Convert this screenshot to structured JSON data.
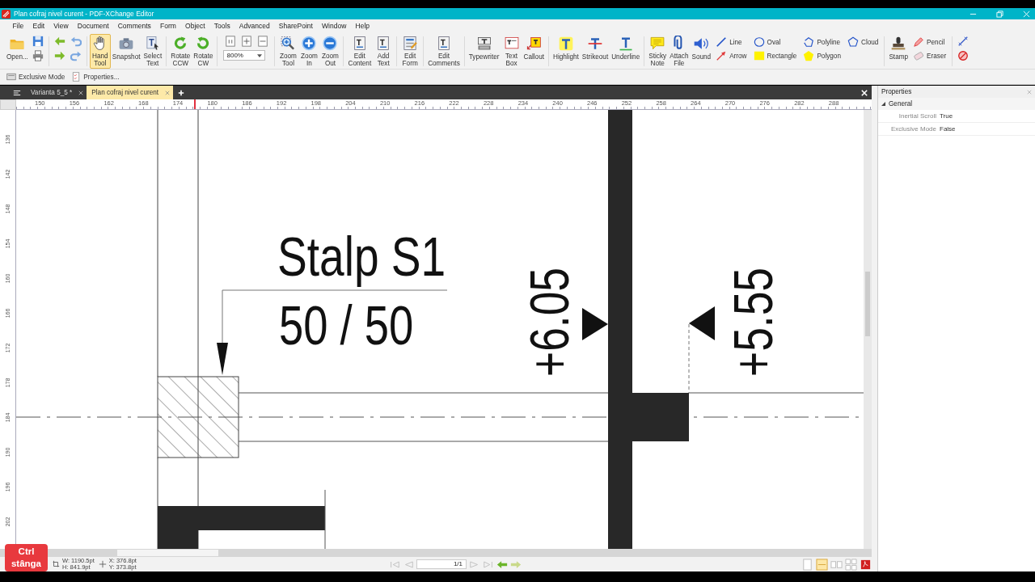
{
  "window": {
    "title": "Plan cofraj nivel curent - PDF-XChange Editor"
  },
  "menu": [
    "File",
    "Edit",
    "View",
    "Document",
    "Comments",
    "Form",
    "Object",
    "Tools",
    "Advanced",
    "SharePoint",
    "Window",
    "Help"
  ],
  "toolbar": [
    {
      "kind": "large",
      "label": "Open...",
      "selected": false
    },
    {
      "kind": "icons"
    },
    {
      "kind": "sep"
    },
    {
      "kind": "icons"
    },
    {
      "kind": "icons"
    },
    {
      "kind": "sep"
    },
    {
      "kind": "large",
      "label": "Hand Tool",
      "selected": true
    },
    {
      "kind": "large",
      "label": "Snapshot",
      "selected": false
    },
    {
      "kind": "large",
      "label": "Select Text",
      "selected": false
    },
    {
      "kind": "sep"
    },
    {
      "kind": "large",
      "label": "Rotate CCW",
      "selected": false
    },
    {
      "kind": "large",
      "label": "Rotate CW",
      "selected": false
    },
    {
      "kind": "sep"
    },
    {
      "kind": "zoom",
      "value": "800%"
    },
    {
      "kind": "sep"
    },
    {
      "kind": "large",
      "label": "Zoom Tool",
      "selected": false
    },
    {
      "kind": "large",
      "label": "Zoom In",
      "selected": false
    },
    {
      "kind": "large",
      "label": "Zoom Out",
      "selected": false
    },
    {
      "kind": "sep"
    },
    {
      "kind": "large",
      "label": "Edit Content",
      "selected": false
    },
    {
      "kind": "large",
      "label": "Add Text",
      "selected": false
    },
    {
      "kind": "sep"
    },
    {
      "kind": "large",
      "label": "Edit Form",
      "selected": false
    },
    {
      "kind": "sep"
    },
    {
      "kind": "large",
      "label": "Edit Comments",
      "selected": false
    },
    {
      "kind": "sep"
    },
    {
      "kind": "large",
      "label": "Typewriter",
      "selected": false
    },
    {
      "kind": "large",
      "label": "Text Box",
      "selected": false
    },
    {
      "kind": "large",
      "label": "Callout",
      "selected": false
    },
    {
      "kind": "sep"
    },
    {
      "kind": "large",
      "label": "Highlight",
      "selected": false
    },
    {
      "kind": "large",
      "label": "Strikeout",
      "selected": false
    },
    {
      "kind": "large",
      "label": "Underline",
      "selected": false
    },
    {
      "kind": "sep"
    },
    {
      "kind": "large",
      "label": "Sticky Note",
      "selected": false
    },
    {
      "kind": "large",
      "label": "Attach File",
      "selected": false
    },
    {
      "kind": "large",
      "label": "Sound",
      "selected": false
    },
    {
      "kind": "pair",
      "items": [
        "Line",
        "Arrow"
      ]
    },
    {
      "kind": "pair",
      "items": [
        "Oval",
        "Rectangle"
      ]
    },
    {
      "kind": "pair",
      "items": [
        "Polyline",
        "Polygon"
      ]
    },
    {
      "kind": "pair",
      "items": [
        "Cloud"
      ]
    },
    {
      "kind": "sep"
    },
    {
      "kind": "large",
      "label": "Stamp",
      "selected": false
    },
    {
      "kind": "pair",
      "items": [
        "Pencil",
        "Eraser"
      ]
    },
    {
      "kind": "sep"
    },
    {
      "kind": "icons"
    }
  ],
  "toolbar2": [
    "Exclusive Mode",
    "Properties..."
  ],
  "tabs": [
    {
      "label": "Varianta 5_5 *",
      "selected": false
    },
    {
      "label": "Plan cofraj nivel curent",
      "selected": true
    }
  ],
  "ruler": {
    "horizontal": [
      "150",
      "156",
      "162",
      "168",
      "174",
      "180",
      "186",
      "192",
      "198",
      "204",
      "210",
      "216",
      "222",
      "228",
      "234",
      "240",
      "246",
      "252",
      "258",
      "264",
      "270",
      "276",
      "282",
      "288"
    ],
    "vertical": [
      "136",
      "142",
      "148",
      "154",
      "160",
      "166",
      "172",
      "178",
      "184",
      "190",
      "196",
      "202"
    ]
  },
  "drawing": {
    "title": "Stalp S1",
    "size": "50 / 50",
    "elevations": [
      "+6.05",
      "+5.55"
    ]
  },
  "properties": {
    "title": "Properties",
    "section": "General",
    "rows": [
      {
        "name": "Inertial Scroll",
        "value": "True"
      },
      {
        "name": "Exclusive Mode",
        "value": "False"
      }
    ]
  },
  "status": {
    "key_overlay": "Ctrl stânga",
    "width": "W: 1190.5pt",
    "height": "H: 841.9pt",
    "x": "X: 376.8pt",
    "y": "Y: 373.8pt",
    "page": "1/1"
  }
}
